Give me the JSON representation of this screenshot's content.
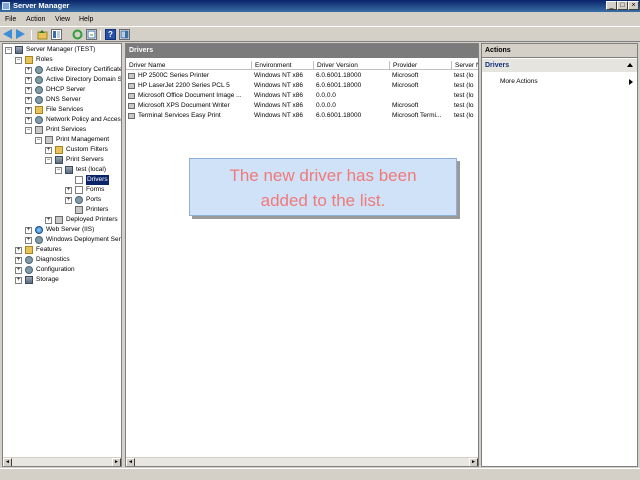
{
  "window": {
    "title": "Server Manager"
  },
  "menu": [
    "File",
    "Action",
    "View",
    "Help"
  ],
  "tree": [
    {
      "label": "Server Manager (TEST)",
      "indent": 0,
      "exp": "minus",
      "icon": "srv"
    },
    {
      "label": "Roles",
      "indent": 1,
      "exp": "minus",
      "icon": "fold"
    },
    {
      "label": "Active Directory Certificate",
      "indent": 2,
      "exp": "plus",
      "icon": "gear"
    },
    {
      "label": "Active Directory Domain Se",
      "indent": 2,
      "exp": "plus",
      "icon": "gear"
    },
    {
      "label": "DHCP Server",
      "indent": 2,
      "exp": "plus",
      "icon": "gear"
    },
    {
      "label": "DNS Server",
      "indent": 2,
      "exp": "plus",
      "icon": "gear"
    },
    {
      "label": "File Services",
      "indent": 2,
      "exp": "plus",
      "icon": "fold"
    },
    {
      "label": "Network Policy and Access",
      "indent": 2,
      "exp": "plus",
      "icon": "gear"
    },
    {
      "label": "Print Services",
      "indent": 2,
      "exp": "minus",
      "icon": "printer"
    },
    {
      "label": "Print Management",
      "indent": 3,
      "exp": "minus",
      "icon": "printer"
    },
    {
      "label": "Custom Filters",
      "indent": 4,
      "exp": "plus",
      "icon": "fold"
    },
    {
      "label": "Print Servers",
      "indent": 4,
      "exp": "minus",
      "icon": "srv"
    },
    {
      "label": "test (local)",
      "indent": 5,
      "exp": "minus",
      "icon": "srv"
    },
    {
      "label": "Drivers",
      "indent": 6,
      "exp": "none",
      "icon": "doc",
      "selected": true
    },
    {
      "label": "Forms",
      "indent": 6,
      "exp": "plus",
      "icon": "doc"
    },
    {
      "label": "Ports",
      "indent": 6,
      "exp": "plus",
      "icon": "gear"
    },
    {
      "label": "Printers",
      "indent": 6,
      "exp": "none",
      "icon": "printer"
    },
    {
      "label": "Deployed Printers",
      "indent": 4,
      "exp": "plus",
      "icon": "printer"
    },
    {
      "label": "Web Server (IIS)",
      "indent": 2,
      "exp": "plus",
      "icon": "globe"
    },
    {
      "label": "Windows Deployment Servi",
      "indent": 2,
      "exp": "plus",
      "icon": "gear"
    },
    {
      "label": "Features",
      "indent": 1,
      "exp": "plus",
      "icon": "fold"
    },
    {
      "label": "Diagnostics",
      "indent": 1,
      "exp": "plus",
      "icon": "gear"
    },
    {
      "label": "Configuration",
      "indent": 1,
      "exp": "plus",
      "icon": "gear"
    },
    {
      "label": "Storage",
      "indent": 1,
      "exp": "plus",
      "icon": "srv"
    }
  ],
  "center": {
    "header": "Drivers",
    "columns": [
      "Driver Name",
      "Environment",
      "Driver Version",
      "Provider",
      "Server N"
    ],
    "rows": [
      [
        "HP 2500C Series Printer",
        "Windows NT x86",
        "6.0.6001.18000",
        "Microsoft",
        "test (lo"
      ],
      [
        "HP LaserJet 2200 Series PCL 5",
        "Windows NT x86",
        "6.0.6001.18000",
        "Microsoft",
        "test (lo"
      ],
      [
        "Microsoft Office Document Image ...",
        "Windows NT x86",
        "0.0.0.0",
        "",
        "test (lo"
      ],
      [
        "Microsoft XPS Document Writer",
        "Windows NT x86",
        "0.0.0.0",
        "Microsoft",
        "test (lo"
      ],
      [
        "Terminal Services Easy Print",
        "Windows NT x86",
        "6.0.6001.18000",
        "Microsoft Termi...",
        "test (lo"
      ]
    ]
  },
  "callout": {
    "line1": "The new driver has been",
    "line2": "added to the list."
  },
  "actions": {
    "header": "Actions",
    "section": "Drivers",
    "item": "More Actions"
  }
}
